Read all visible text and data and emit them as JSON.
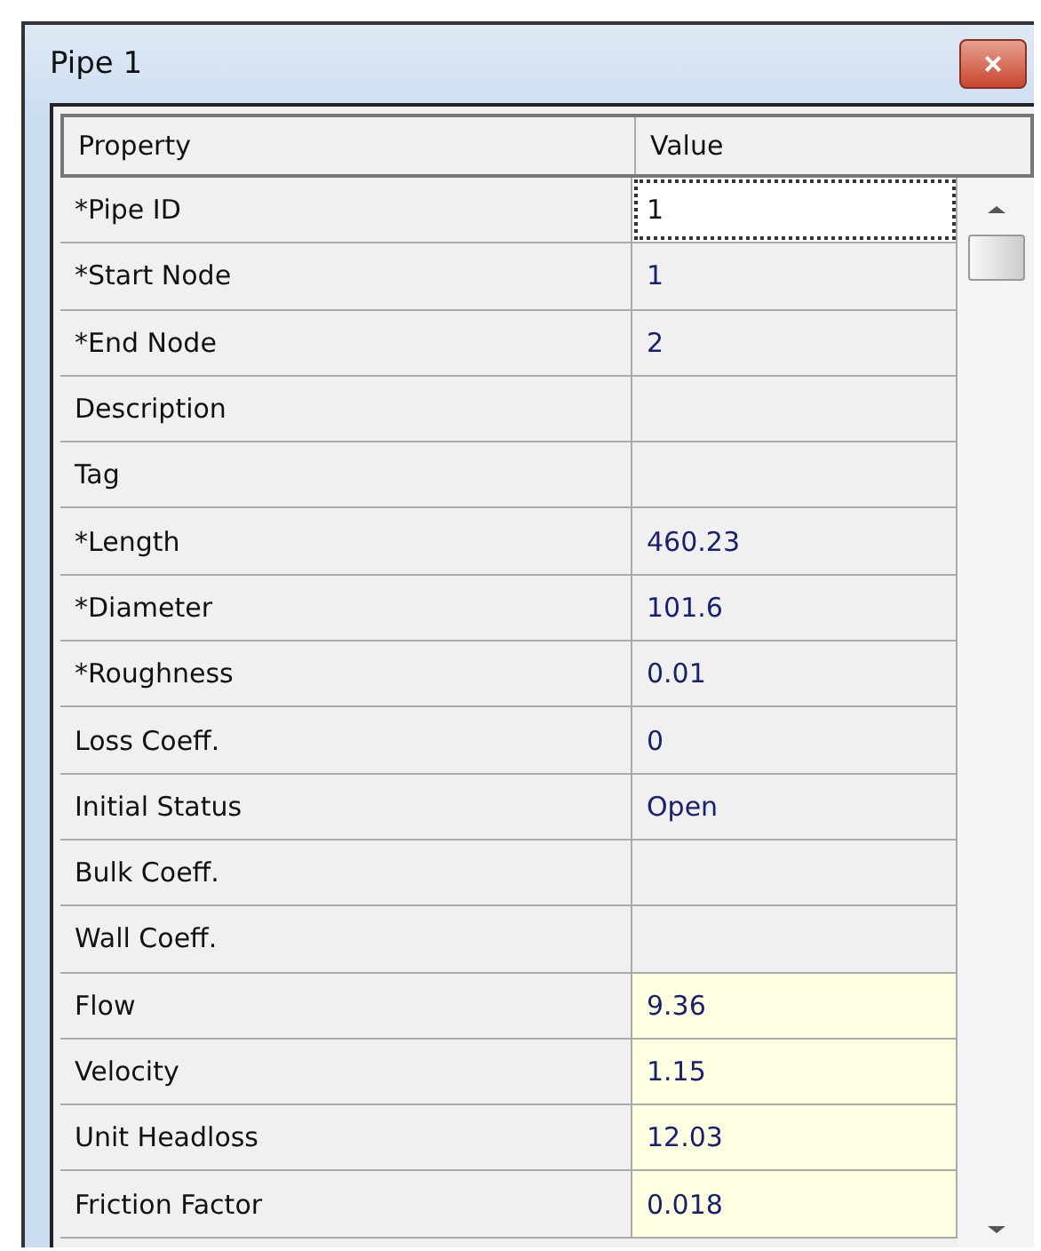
{
  "window": {
    "title": "Pipe 1",
    "close": "×"
  },
  "table": {
    "columns": [
      "Property",
      "Value"
    ],
    "rows": [
      {
        "property": "*Pipe ID",
        "value": "1",
        "kind": "input",
        "selected": true
      },
      {
        "property": "*Start Node",
        "value": "1",
        "kind": "input",
        "selected": false
      },
      {
        "property": "*End Node",
        "value": "2",
        "kind": "input",
        "selected": false
      },
      {
        "property": "Description",
        "kind": "input",
        "selected": false
      },
      {
        "property": "Tag",
        "kind": "input",
        "selected": false
      },
      {
        "property": "*Length",
        "value": "460.23",
        "kind": "input",
        "selected": false
      },
      {
        "property": "*Diameter",
        "value": "101.6",
        "kind": "input",
        "selected": false
      },
      {
        "property": "*Roughness",
        "value": "0.01",
        "kind": "input",
        "selected": false
      },
      {
        "property": "Loss Coeff.",
        "value": "0",
        "kind": "input",
        "selected": false
      },
      {
        "property": "Initial Status",
        "value": "Open",
        "kind": "input",
        "selected": false
      },
      {
        "property": "Bulk Coeff.",
        "kind": "input",
        "selected": false
      },
      {
        "property": "Wall Coeff.",
        "kind": "input",
        "selected": false
      },
      {
        "property": "Flow",
        "value": "9.36",
        "kind": "result",
        "selected": false
      },
      {
        "property": "Velocity",
        "value": "1.15",
        "kind": "result",
        "selected": false
      },
      {
        "property": "Unit Headloss",
        "value": "12.03",
        "kind": "result",
        "selected": false
      },
      {
        "property": "Friction Factor",
        "value": "0.018",
        "kind": "result",
        "selected": false
      }
    ]
  }
}
